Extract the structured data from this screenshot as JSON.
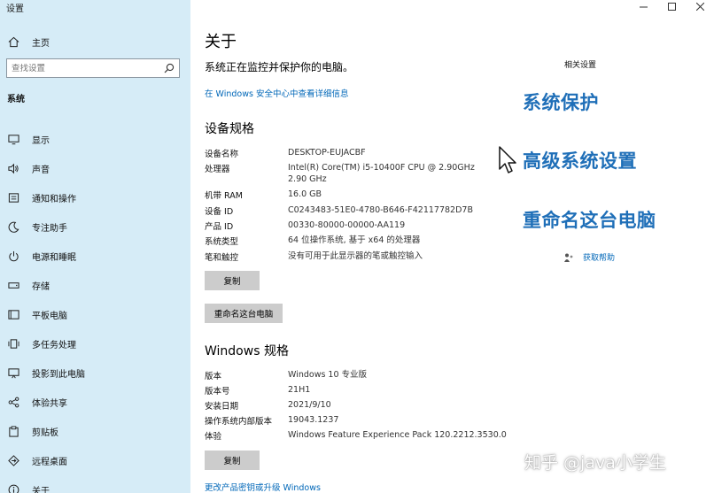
{
  "window": {
    "title": "设置",
    "controls": [
      "minimize",
      "maximize",
      "close"
    ]
  },
  "sidebar": {
    "home_label": "主页",
    "search_placeholder": "查找设置",
    "section_label": "系统",
    "items": [
      {
        "label": "显示",
        "icon": "monitor-icon"
      },
      {
        "label": "声音",
        "icon": "speaker-icon"
      },
      {
        "label": "通知和操作",
        "icon": "notification-icon"
      },
      {
        "label": "专注助手",
        "icon": "moon-icon"
      },
      {
        "label": "电源和睡眠",
        "icon": "power-icon"
      },
      {
        "label": "存储",
        "icon": "storage-icon"
      },
      {
        "label": "平板电脑",
        "icon": "tablet-icon"
      },
      {
        "label": "多任务处理",
        "icon": "multitask-icon"
      },
      {
        "label": "投影到此电脑",
        "icon": "project-icon"
      },
      {
        "label": "体验共享",
        "icon": "share-icon"
      },
      {
        "label": "剪贴板",
        "icon": "clipboard-icon"
      },
      {
        "label": "远程桌面",
        "icon": "remote-desktop-icon"
      },
      {
        "label": "关于",
        "icon": "info-icon"
      }
    ]
  },
  "main": {
    "title": "关于",
    "status": "系统正在监控并保护你的电脑。",
    "security_link": "在 Windows 安全中心中查看详细信息",
    "device_specs": {
      "heading": "设备规格",
      "rows": [
        {
          "key": "设备名称",
          "value": "DESKTOP-EUJACBF"
        },
        {
          "key": "处理器",
          "value": "Intel(R) Core(TM) i5-10400F CPU @ 2.90GHz   2.90 GHz"
        },
        {
          "key": "机带 RAM",
          "value": "16.0 GB"
        },
        {
          "key": "设备 ID",
          "value": "C0243483-51E0-4780-B646-F42117782D7B"
        },
        {
          "key": "产品 ID",
          "value": "00330-80000-00000-AA119"
        },
        {
          "key": "系统类型",
          "value": "64 位操作系统, 基于 x64 的处理器"
        },
        {
          "key": "笔和触控",
          "value": "没有可用于此显示器的笔或触控输入"
        }
      ],
      "copy_button": "复制",
      "rename_button": "重命名这台电脑"
    },
    "windows_specs": {
      "heading": "Windows 规格",
      "rows": [
        {
          "key": "版本",
          "value": "Windows 10 专业版"
        },
        {
          "key": "版本号",
          "value": "21H1"
        },
        {
          "key": "安装日期",
          "value": "2021/9/10"
        },
        {
          "key": "操作系统内部版本",
          "value": "19043.1237"
        },
        {
          "key": "体验",
          "value": "Windows Feature Experience Pack 120.2212.3530.0"
        }
      ],
      "copy_button": "复制",
      "upgrade_link": "更改产品密钥或升级 Windows"
    }
  },
  "related": {
    "title": "相关设置",
    "links": [
      "系统保护",
      "高级系统设置",
      "重命名这台电脑"
    ],
    "help_link": "获取帮助"
  },
  "watermark": "知乎 @java小学生",
  "colors": {
    "sidebar_bg": "#d6ecf7",
    "link": "#0067b8",
    "big_link": "#1f6fb8",
    "button_bg": "#cccccc"
  }
}
